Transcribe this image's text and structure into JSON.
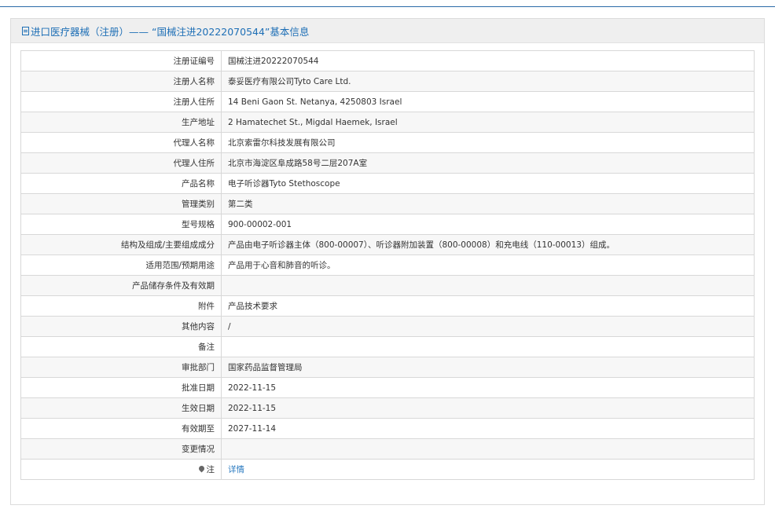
{
  "header": {
    "icon": "document-icon",
    "title": "进口医疗器械（注册）—— “国械注进20222070544”基本信息"
  },
  "rows": [
    {
      "label": "注册证编号",
      "value": "国械注进20222070544"
    },
    {
      "label": "注册人名称",
      "value": "泰妥医疗有限公司Tyto Care Ltd."
    },
    {
      "label": "注册人住所",
      "value": "14 Beni Gaon St. Netanya, 4250803 Israel"
    },
    {
      "label": "生产地址",
      "value": "2 Hamatechet St., Migdal Haemek, Israel"
    },
    {
      "label": "代理人名称",
      "value": "北京索雷尔科技发展有限公司"
    },
    {
      "label": "代理人住所",
      "value": "北京市海淀区阜成路58号二层207A室"
    },
    {
      "label": "产品名称",
      "value": "电子听诊器Tyto Stethoscope"
    },
    {
      "label": "管理类别",
      "value": "第二类"
    },
    {
      "label": "型号规格",
      "value": "900-00002-001"
    },
    {
      "label": "结构及组成/主要组成成分",
      "value": "产品由电子听诊器主体（800-00007）、听诊器附加装置（800-00008）和充电线（110-00013）组成。"
    },
    {
      "label": "适用范围/预期用途",
      "value": "产品用于心音和肺音的听诊。"
    },
    {
      "label": "产品储存条件及有效期",
      "value": ""
    },
    {
      "label": "附件",
      "value": "产品技术要求"
    },
    {
      "label": "其他内容",
      "value": "/"
    },
    {
      "label": "备注",
      "value": ""
    },
    {
      "label": "审批部门",
      "value": "国家药品监督管理局"
    },
    {
      "label": "批准日期",
      "value": "2022-11-15"
    },
    {
      "label": "生效日期",
      "value": "2022-11-15"
    },
    {
      "label": "有效期至",
      "value": "2027-11-14"
    },
    {
      "label": "变更情况",
      "value": ""
    }
  ],
  "note_row": {
    "icon": "map-pin-icon",
    "label": "注",
    "link": "详情"
  }
}
